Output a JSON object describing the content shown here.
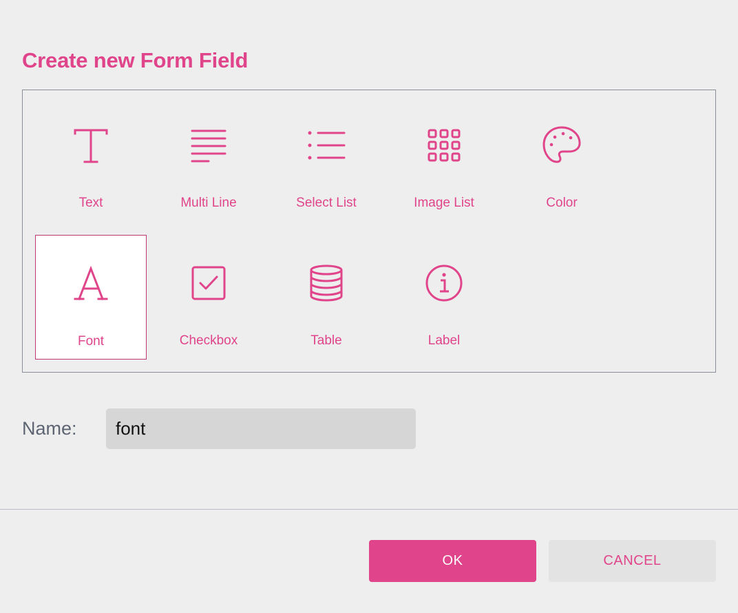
{
  "dialog": {
    "title": "Create new Form Field"
  },
  "field_types": [
    {
      "label": "Text",
      "icon": "text-icon",
      "selected": false
    },
    {
      "label": "Multi Line",
      "icon": "multi-line-icon",
      "selected": false
    },
    {
      "label": "Select List",
      "icon": "list-icon",
      "selected": false
    },
    {
      "label": "Image List",
      "icon": "grid-icon",
      "selected": false
    },
    {
      "label": "Color",
      "icon": "palette-icon",
      "selected": false
    },
    {
      "label": "Font",
      "icon": "font-icon",
      "selected": true
    },
    {
      "label": "Checkbox",
      "icon": "checkbox-icon",
      "selected": false
    },
    {
      "label": "Table",
      "icon": "database-icon",
      "selected": false
    },
    {
      "label": "Label",
      "icon": "info-icon",
      "selected": false
    }
  ],
  "name_field": {
    "label": "Name:",
    "value": "font"
  },
  "buttons": {
    "ok_label": "OK",
    "cancel_label": "CANCEL"
  },
  "colors": {
    "accent": "#e0448a",
    "background": "#eeeeee",
    "input_background": "#d6d6d6",
    "label_gray": "#5d6573"
  }
}
